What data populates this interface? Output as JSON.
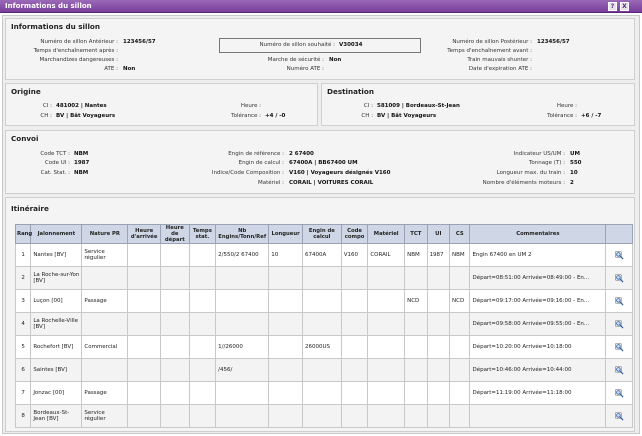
{
  "window": {
    "title": "Informations du sillon",
    "help_label": "?",
    "close_label": "X"
  },
  "sillon": {
    "title": "Informations du sillon",
    "left": [
      {
        "label": "Numéro de sillon Antérieur :",
        "value": "123456/57"
      },
      {
        "label": "Temps d'enchaînement après :",
        "value": ""
      },
      {
        "label": "Marchandizes dangereuses :",
        "value": ""
      },
      {
        "label": "ATE :",
        "value": "Non"
      }
    ],
    "center": [
      {
        "label": "Numéro de sillon souhaité :",
        "value": "V30034"
      },
      {
        "label": "Marche de sécurité :",
        "value": "Non"
      },
      {
        "label": "Numéro ATE :",
        "value": ""
      }
    ],
    "right": [
      {
        "label": "Numéro de sillon Postérieur :",
        "value": "123456/57"
      },
      {
        "label": "Temps d'enchaînement avant :",
        "value": ""
      },
      {
        "label": "Train mauvais shunter :",
        "value": ""
      },
      {
        "label": "Date d'expiration ATE :",
        "value": ""
      }
    ]
  },
  "origine": {
    "title": "Origine",
    "ci_label": "CI :",
    "ci_value": "481002 | Nantes",
    "ch_label": "CH :",
    "ch_value": "BV | Bât Voyageurs",
    "heure_label": "Heure :",
    "heure_value": "",
    "tol_label": "Tolérance :",
    "tol_value": "+4 / -0"
  },
  "destination": {
    "title": "Destination",
    "ci_label": "CI :",
    "ci_value": "581009 | Bordeaux-St-Jean",
    "ch_label": "CH :",
    "ch_value": "BV | Bât Voyageurs",
    "heure_label": "Heure :",
    "heure_value": "",
    "tol_label": "Tolérance :",
    "tol_value": "+6 / -7"
  },
  "convoi": {
    "title": "Convoi",
    "left": [
      {
        "label": "Code TCT :",
        "value": "NBM"
      },
      {
        "label": "Code UI :",
        "value": "1987"
      },
      {
        "label": "Cat. Stat. :",
        "value": "NBM"
      }
    ],
    "center": [
      {
        "label": "Engin de référence :",
        "value": "2 67400"
      },
      {
        "label": "Engin de calcul :",
        "value": "67400A | BB67400 UM"
      },
      {
        "label": "Indice/Code Composition :",
        "value": "V160 | Voyageurs désignés V160"
      },
      {
        "label": "Matériel :",
        "value": "CORAIL | VOITURES CORAIL"
      }
    ],
    "right": [
      {
        "label": "Indicateur US/UM :",
        "value": "UM"
      },
      {
        "label": "Tonnage (T) :",
        "value": "550"
      },
      {
        "label": "Longueur max. du train :",
        "value": "10"
      },
      {
        "label": "Nombre d'éléments moteurs :",
        "value": "2"
      }
    ]
  },
  "itineraire": {
    "title": "Itinéraire",
    "columns": [
      "Rang",
      "Jalonnement",
      "Nature PR",
      "Heure d'arrivée",
      "Heure de départ",
      "Temps stat.",
      "Nb Engins/Tonn/Ref",
      "Longueur",
      "Engin de calcul",
      "Code compo",
      "Matériel",
      "TCT",
      "UI",
      "CS",
      "Commentaires",
      ""
    ],
    "rows": [
      [
        "1",
        "Nantes [BV]",
        "Service régulier",
        "",
        "",
        "",
        "2/550/2 67400",
        "10",
        "67400A",
        "V160",
        "CORAIL",
        "NBM",
        "1987",
        "NBM",
        "Engin 67400 en UM 2"
      ],
      [
        "2",
        "La Roche-sur-Yon [BV]",
        "",
        "",
        "",
        "",
        "",
        "",
        "",
        "",
        "",
        "",
        "",
        "",
        "Départ=08:51:00 Arrivée=08:49:00 - En..."
      ],
      [
        "3",
        "Luçon [00]",
        "Passage",
        "",
        "",
        "",
        "",
        "",
        "",
        "",
        "",
        "NCD",
        "",
        "NCD",
        "Départ=09:17:00 Arrivée=09:16:00 - En..."
      ],
      [
        "4",
        "La Rochelle-Ville [BV]",
        "",
        "",
        "",
        "",
        "",
        "",
        "",
        "",
        "",
        "",
        "",
        "",
        "Départ=09:58:00 Arrivée=09:55:00 - En..."
      ],
      [
        "5",
        "Rochefort [BV]",
        "Commercial",
        "",
        "",
        "",
        "1//26000",
        "",
        "26000US",
        "",
        "",
        "",
        "",
        "",
        "Départ=10:20:00 Arrivée=10:18:00"
      ],
      [
        "6",
        "Saintes [BV]",
        "",
        "",
        "",
        "",
        "/456/",
        "",
        "",
        "",
        "",
        "",
        "",
        "",
        "Départ=10:46:00 Arrivée=10:44:00"
      ],
      [
        "7",
        "Jonzac [00]",
        "Passage",
        "",
        "",
        "",
        "",
        "",
        "",
        "",
        "",
        "",
        "",
        "",
        "Départ=11:19:00 Arrivée=11:18:00"
      ],
      [
        "8",
        "Bordeaux-St-Jean [BV]",
        "Service régulier",
        "",
        "",
        "",
        "",
        "",
        "",
        "",
        "",
        "",
        "",
        "",
        ""
      ]
    ]
  },
  "icons": {
    "detail": "magnifier-icon"
  },
  "colors": {
    "titlebar": "#7a3c9c",
    "table_header": "#cfd6e6",
    "panel_bg": "#f4f4f4"
  }
}
